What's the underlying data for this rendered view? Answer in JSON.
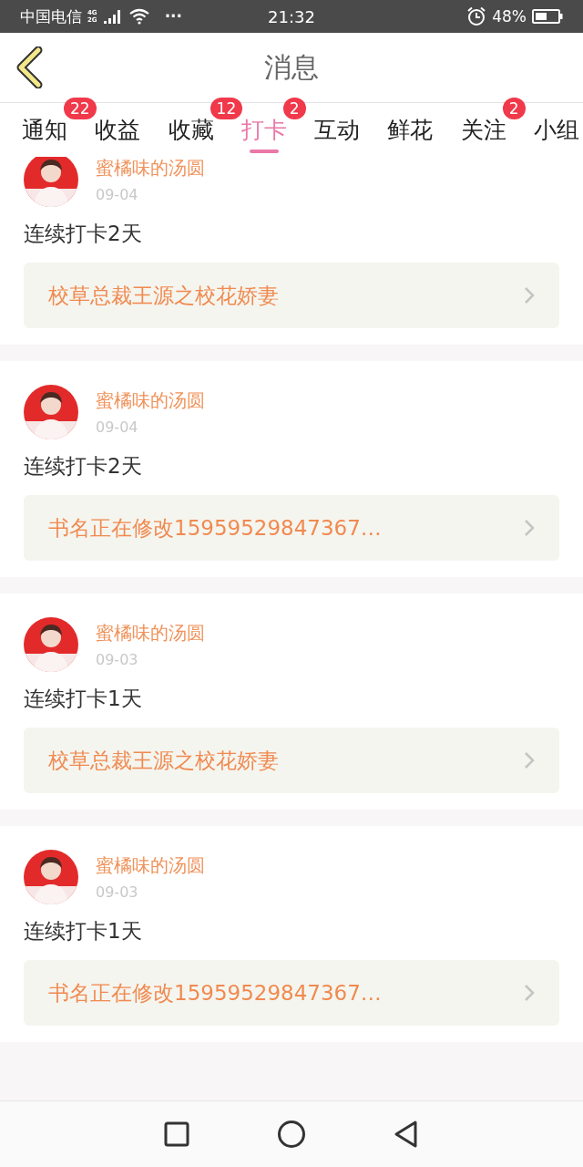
{
  "status_bar": {
    "carrier": "中国电信",
    "network_top": "4G",
    "network_bottom": "2G",
    "more": "···",
    "time": "21:32",
    "battery": "48%"
  },
  "header": {
    "title": "消息"
  },
  "tabs": [
    {
      "label": "通知",
      "badge": "22",
      "selected": false
    },
    {
      "label": "收益",
      "selected": false
    },
    {
      "label": "收藏",
      "badge": "12",
      "selected": false
    },
    {
      "label": "打卡",
      "badge": "2",
      "selected": true
    },
    {
      "label": "互动",
      "selected": false
    },
    {
      "label": "鲜花",
      "selected": false
    },
    {
      "label": "关注",
      "badge": "2",
      "selected": false
    },
    {
      "label": "小组",
      "selected": false
    }
  ],
  "messages": [
    {
      "user": "蜜橘味的汤圆",
      "date": "09-04",
      "text": "连续打卡2天",
      "book": "校草总裁王源之校花娇妻"
    },
    {
      "user": "蜜橘味的汤圆",
      "date": "09-04",
      "text": "连续打卡2天",
      "book": "书名正在修改15959529847367…"
    },
    {
      "user": "蜜橘味的汤圆",
      "date": "09-03",
      "text": "连续打卡1天",
      "book": "校草总裁王源之校花娇妻"
    },
    {
      "user": "蜜橘味的汤圆",
      "date": "09-03",
      "text": "连续打卡1天",
      "book": "书名正在修改15959529847367…"
    }
  ]
}
